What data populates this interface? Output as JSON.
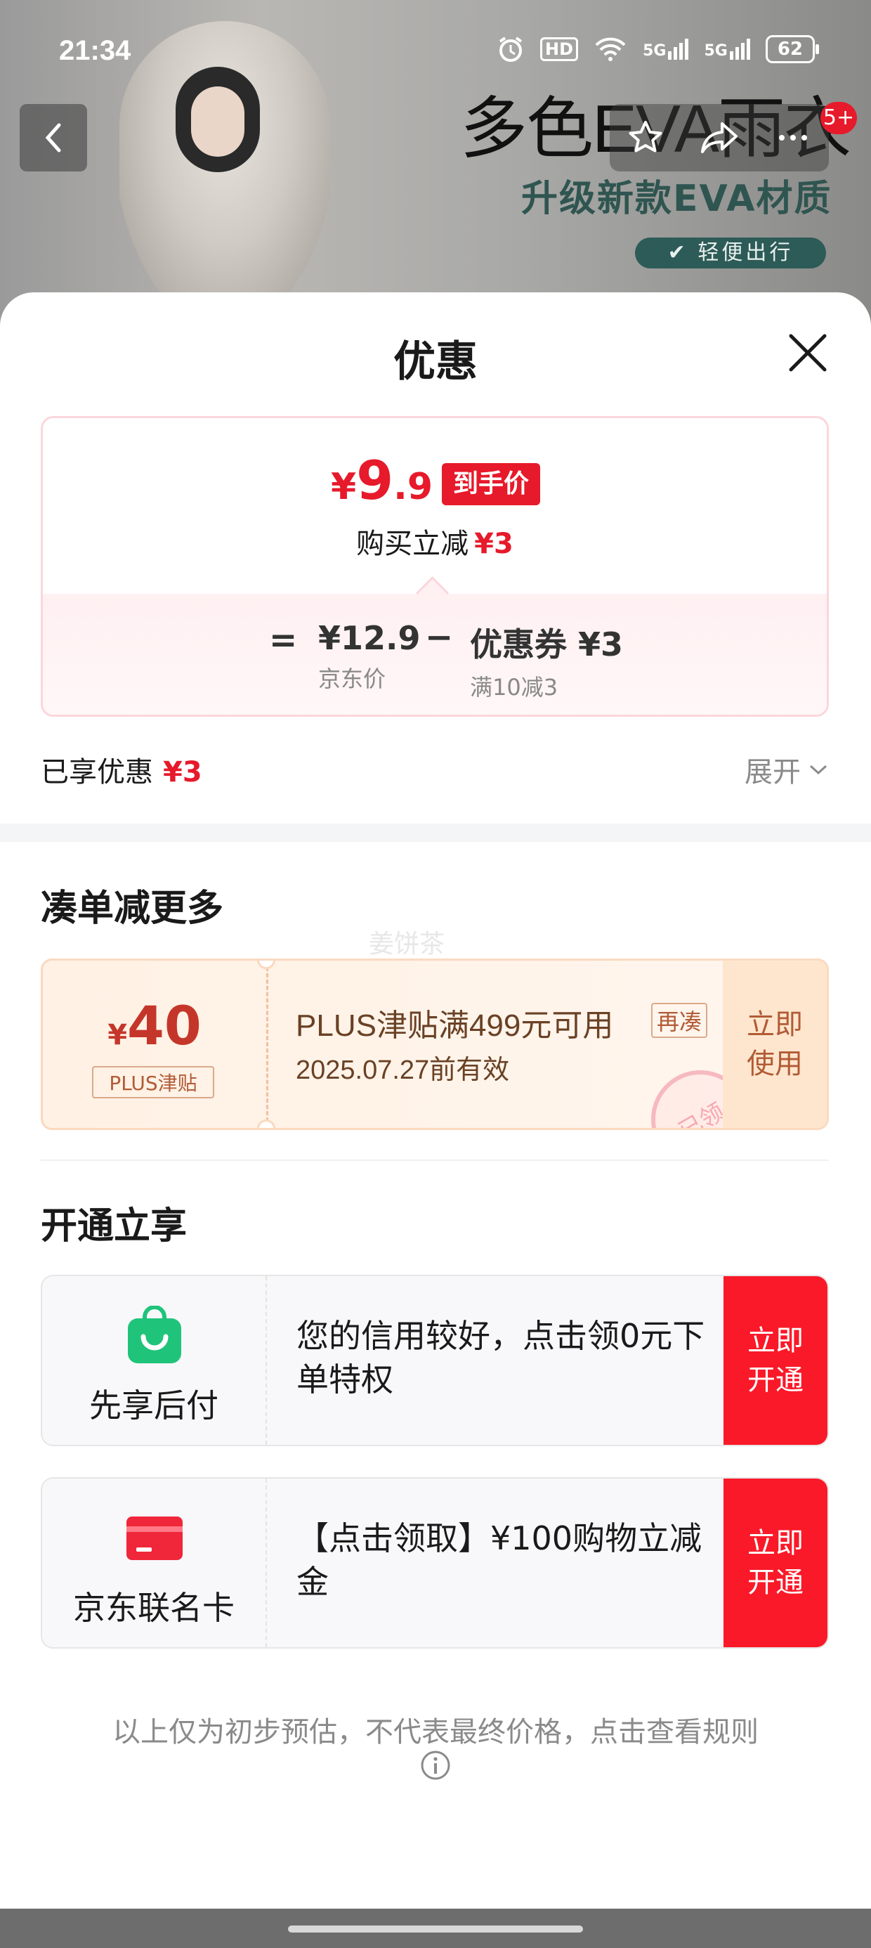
{
  "status_bar": {
    "time": "21:34",
    "hd": "HD",
    "network_1": "5G",
    "network_2": "5G",
    "battery": "62"
  },
  "banner": {
    "title": "多色EVA雨衣",
    "subtitle": "升级新款EVA材质",
    "tag": "✔ 轻便出行",
    "cart_badge": "5+"
  },
  "sheet": {
    "title": "优惠"
  },
  "price_card": {
    "currency": "¥",
    "price_int": "9",
    "price_dec": ".9",
    "price_tag": "到手价",
    "instant_label": "购买立减",
    "instant_value": "¥3",
    "eq": "=",
    "jd_price_value": "¥12.9",
    "jd_price_label": "京东价",
    "minus": "−",
    "coupon_value": "优惠券 ¥3",
    "coupon_label": "满10减3"
  },
  "savings": {
    "label": "已享优惠",
    "value": "¥3",
    "expand_label": "展开"
  },
  "more_section": {
    "title": "凑单减更多",
    "watermark": "姜饼茶"
  },
  "plus_coupon": {
    "currency": "¥",
    "amount": "40",
    "kind": "PLUS津贴",
    "description": "PLUS津贴满499元可用",
    "chip": "再凑",
    "expiry": "2025.07.27前有效",
    "stamp": "已领",
    "use_line1": "立即",
    "use_line2": "使用"
  },
  "open_section": {
    "title": "开通立享"
  },
  "offers": [
    {
      "name": "先享后付",
      "icon": "shopping-bag-icon",
      "text": "您的信用较好，点击领0元下单特权",
      "btn_line1": "立即",
      "btn_line2": "开通"
    },
    {
      "name": "京东联名卡",
      "icon": "credit-card-icon",
      "text": "【点击领取】¥100购物立减金",
      "btn_line1": "立即",
      "btn_line2": "开通"
    }
  ],
  "disclaimer": "以上仅为初步预估，不代表最终价格，点击查看规则",
  "colors": {
    "accent_red": "#e61a2b",
    "button_red": "#fa1928",
    "coupon_brown": "#6a4125",
    "coupon_bg": "#fff1e4",
    "green_icon": "#1fc47a"
  }
}
